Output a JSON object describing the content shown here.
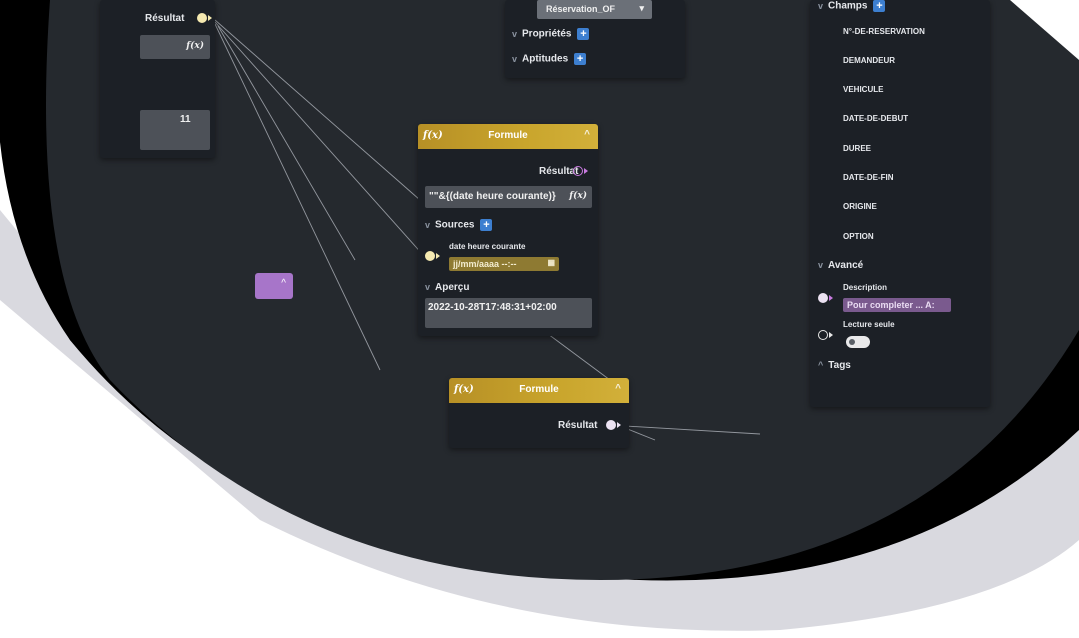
{
  "node_result": {
    "result_label": "Résultat",
    "fx": "f(x)",
    "value": "11"
  },
  "node_entity": {
    "type_value": "Réservation_OF",
    "properties_label": "Propriétés",
    "aptitudes_label": "Aptitudes"
  },
  "node_formula1": {
    "fx": "f(x)",
    "title": "Formule",
    "result_label": "Résultat",
    "formula_value": "\"\"&{(date heure courante)}",
    "formula_fx": "f(x)",
    "sources_label": "Sources",
    "source_name": "date heure courante",
    "source_placeholder": "jj/mm/aaaa --:--",
    "apercu_label": "Aperçu",
    "apercu_value": "2022-10-28T17:48:31+02:00"
  },
  "node_formula2": {
    "fx": "f(x)",
    "title": "Formule",
    "result_label": "Résultat"
  },
  "node_fields": {
    "champs_label": "Champs",
    "fields": [
      "N°-DE-RESERVATION",
      "DEMANDEUR",
      "VEHICULE",
      "DATE-DE-DEBUT",
      "DUREE",
      "DATE-DE-FIN",
      "ORIGINE",
      "OPTION"
    ],
    "avance_label": "Avancé",
    "description_label": "Description",
    "description_value": "Pour completer ... A:",
    "lecture_label": "Lecture seule",
    "tags_label": "Tags"
  },
  "colors": {
    "canvas": "#25292e",
    "node": "#1c2026",
    "formula_header": "#c9a52c",
    "accent_blue": "#3d7fd0",
    "mauve": "#a775c9"
  }
}
